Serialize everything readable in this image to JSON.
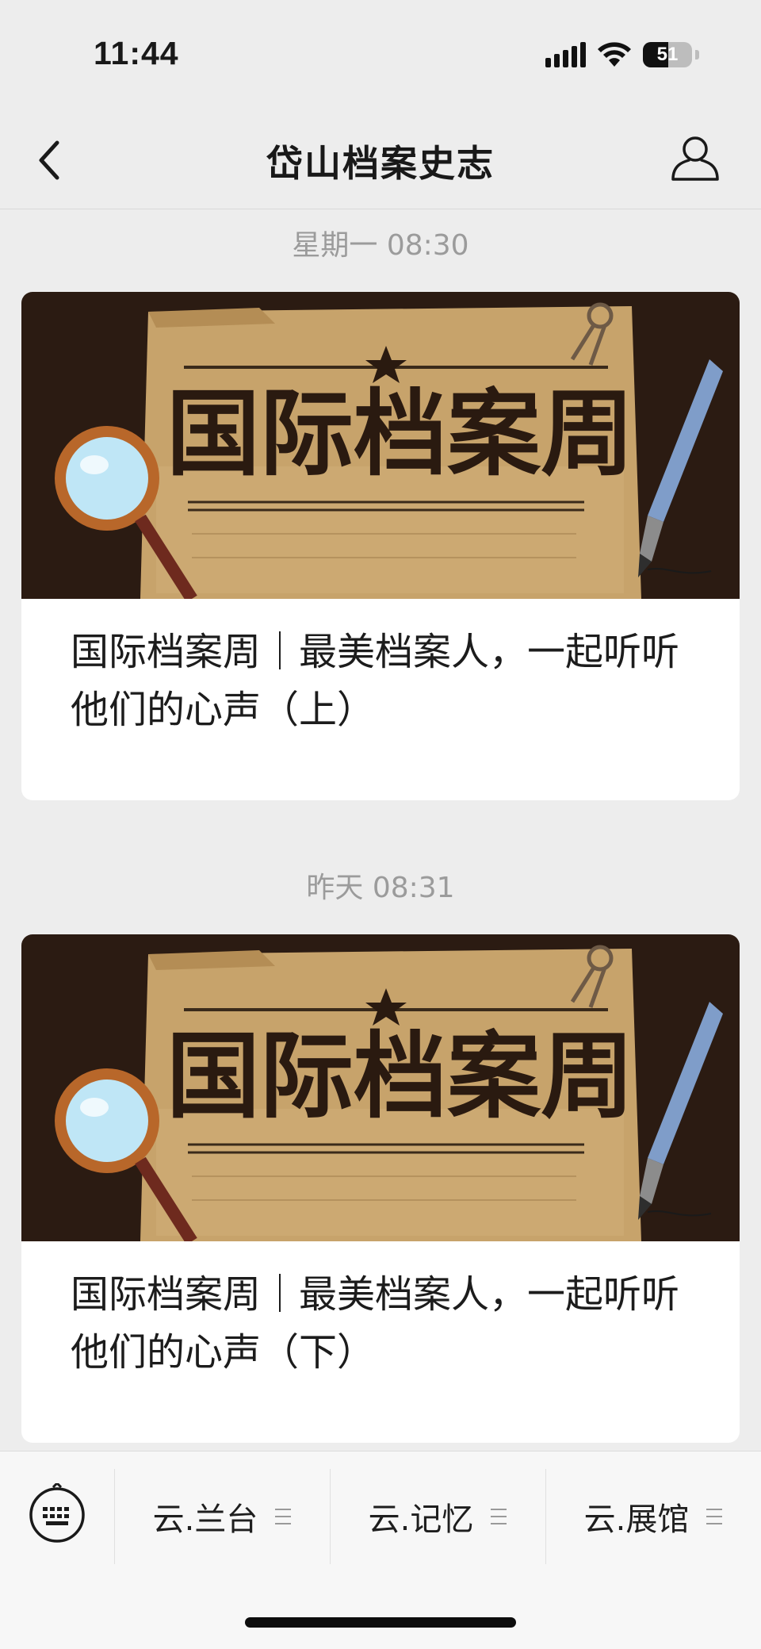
{
  "status_bar": {
    "time": "11:44",
    "battery_level": "51",
    "icons": [
      "signal-icon",
      "wifi-icon",
      "battery-icon"
    ]
  },
  "nav": {
    "title": "岱山档案史志",
    "back_icon": "chevron-left-icon",
    "profile_icon": "person-icon"
  },
  "feed": [
    {
      "timestamp": "星期一 08:30",
      "cover_text": "国际档案周",
      "title": "国际档案周｜最美档案人，一起听听他们的心声（上）"
    },
    {
      "timestamp": "昨天 08:31",
      "cover_text": "国际档案周",
      "title": "国际档案周｜最美档案人，一起听听他们的心声（下）"
    }
  ],
  "bottom_menu": {
    "keyboard_icon": "keyboard-icon",
    "items": [
      {
        "label": "云.兰台"
      },
      {
        "label": "云.记忆"
      },
      {
        "label": "云.展馆"
      }
    ]
  },
  "colors": {
    "background": "#ededed",
    "card": "#ffffff",
    "timestamp": "#9b9b9b",
    "cover_dark": "#2b1b12",
    "parchment": "#c7a36b"
  }
}
